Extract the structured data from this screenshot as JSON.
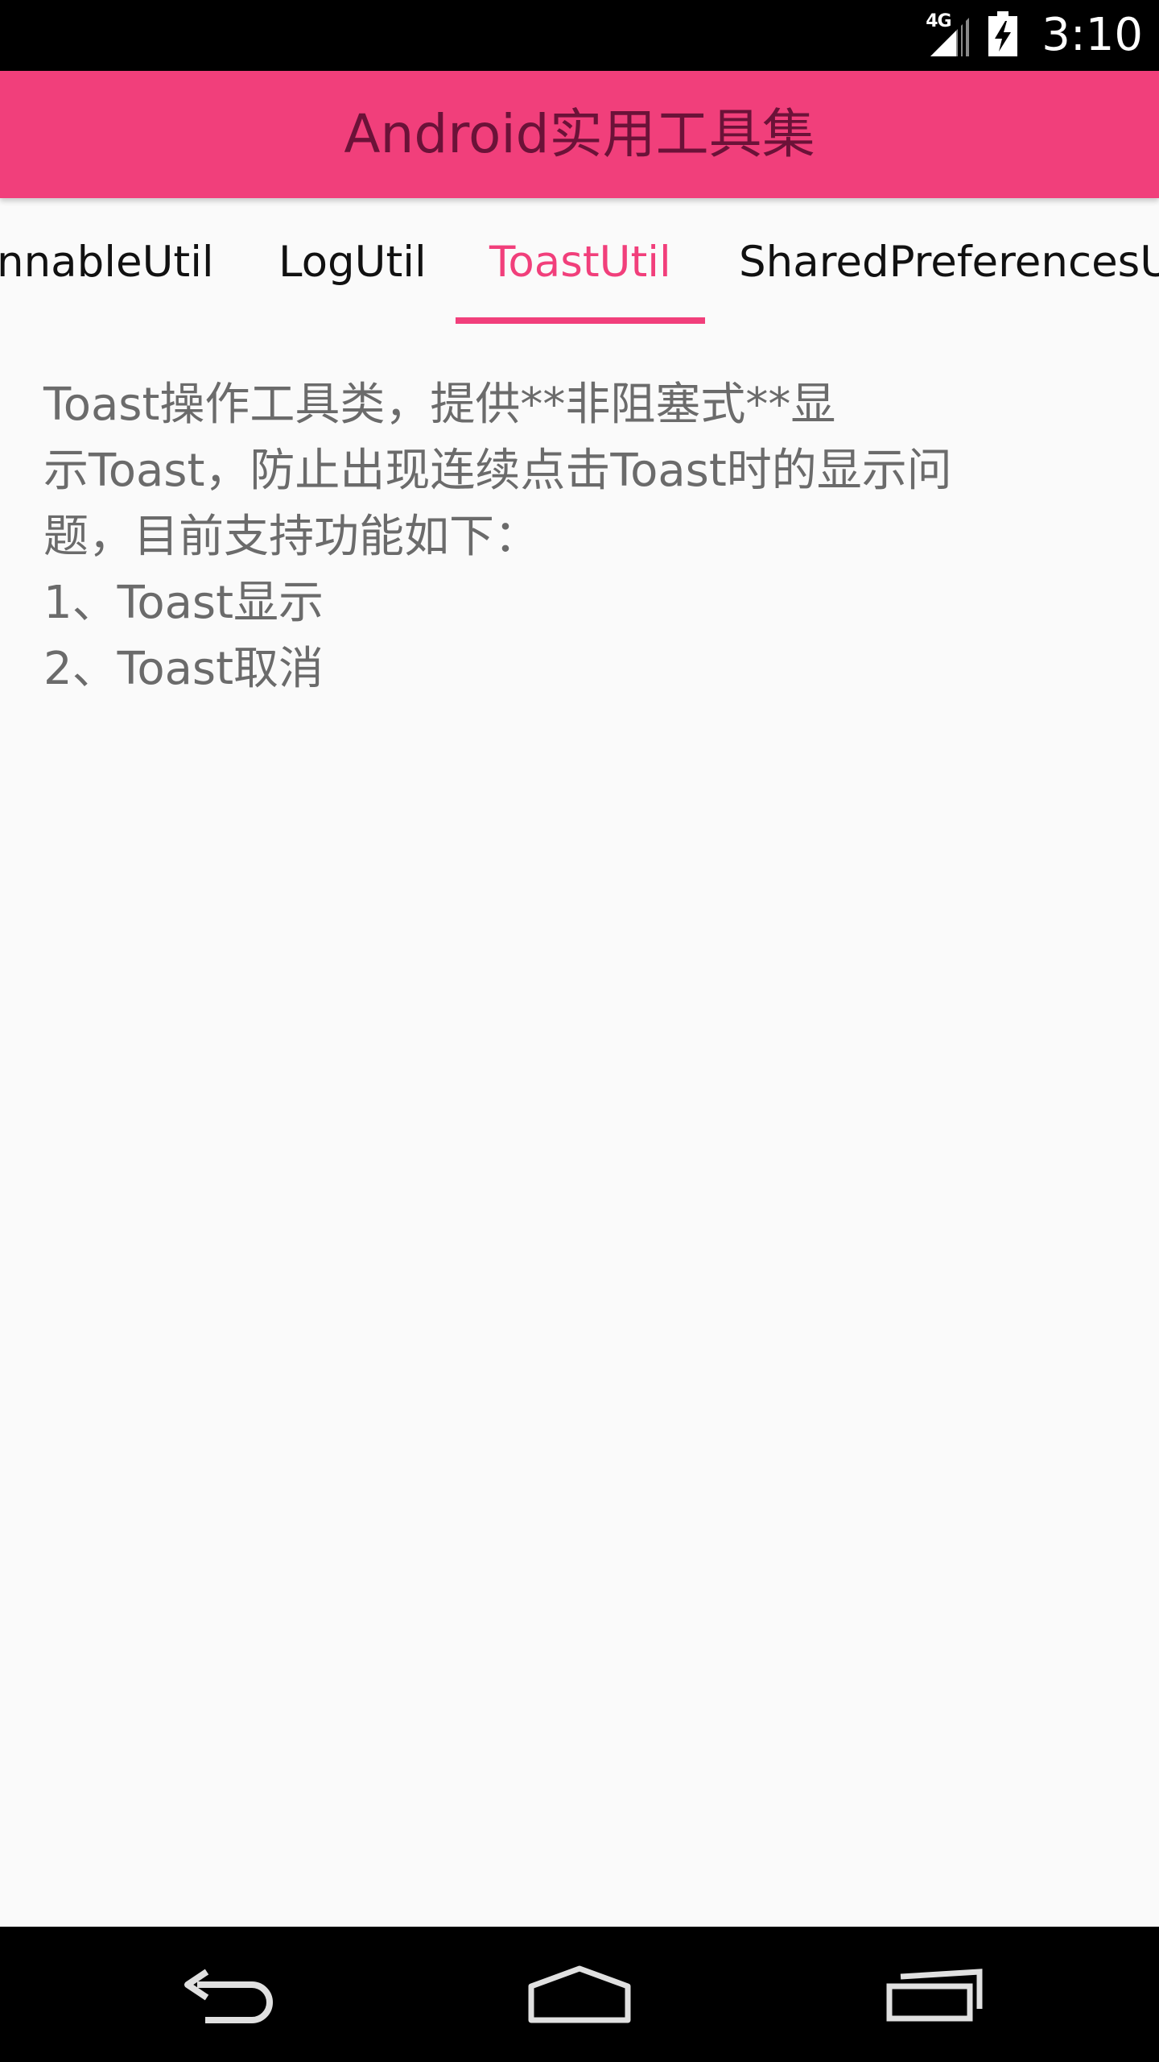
{
  "status_bar": {
    "network_label": "4G",
    "time": "3:10",
    "icons": [
      "signal-icon",
      "battery-charging-icon"
    ]
  },
  "app_bar": {
    "title": "Android实用工具集"
  },
  "tabs": [
    {
      "label": "RunnableUtil",
      "visible_text": "nnableUtil",
      "active": false
    },
    {
      "label": "LogUtil",
      "visible_text": "LogUtil",
      "active": false
    },
    {
      "label": "ToastUtil",
      "visible_text": "ToastUtil",
      "active": true
    },
    {
      "label": "SharedPreferencesUtil",
      "visible_text": "SharedPreferencesUt",
      "active": false
    }
  ],
  "content": {
    "lines": [
      "Toast操作工具类，提供**非阻塞式**显",
      "示Toast，防止出现连续点击Toast时的显示问",
      "题，目前支持功能如下：",
      "1、Toast显示",
      "2、Toast取消"
    ]
  },
  "nav_bar": {
    "buttons": [
      "back-icon",
      "home-icon",
      "recents-icon"
    ]
  },
  "colors": {
    "accent": "#f13f7b",
    "title_text": "#6b1238",
    "body_text": "#6b6b6b",
    "background": "#fafafa"
  }
}
